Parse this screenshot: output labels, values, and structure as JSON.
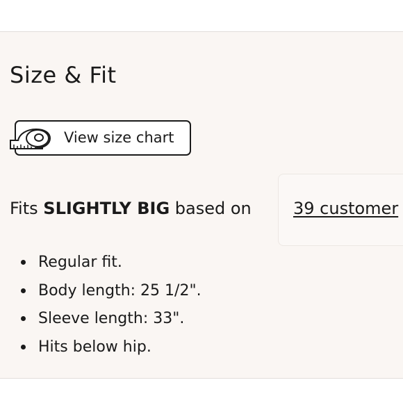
{
  "size_fit": {
    "title": "Size & Fit",
    "size_chart_button": {
      "label": "View size chart",
      "icon": "measuring-tape-icon"
    },
    "fit_summary": {
      "prefix": "Fits",
      "fit_value": "SLIGHTLY BIG",
      "suffix": "based on",
      "reviews_link": "39 customer"
    },
    "details": [
      "Regular fit.",
      "Body length: 25 1/2\".",
      "Sleeve length: 33\".",
      "Hits below hip."
    ]
  },
  "colors": {
    "panel_background": "#faf6f3",
    "text": "#1a1a1a",
    "border": "#e2dedb"
  }
}
